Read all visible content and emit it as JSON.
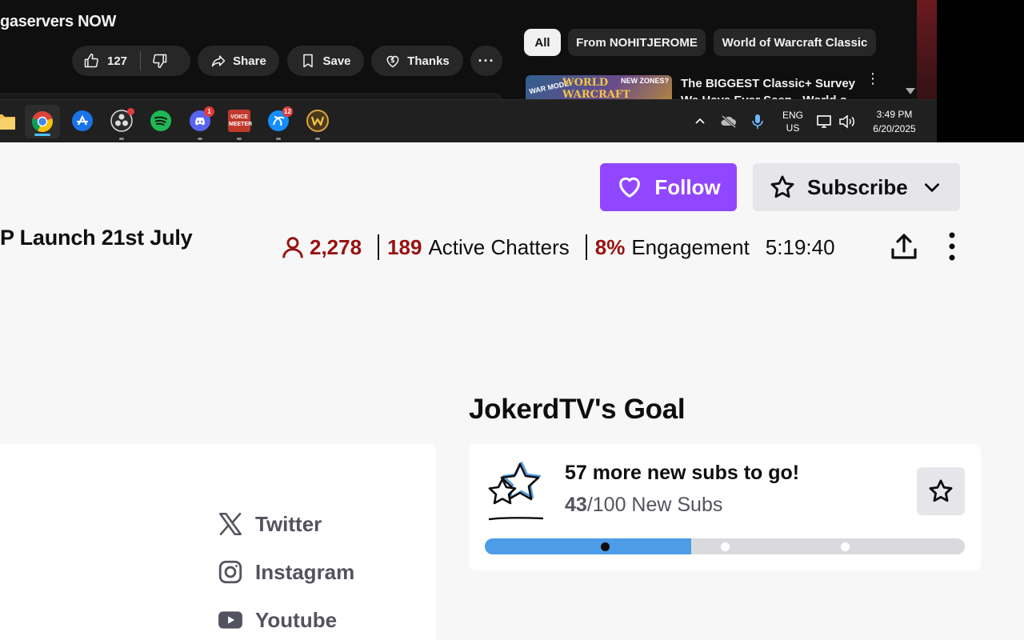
{
  "capture": {
    "video_title": "gaservers NOW",
    "actions": {
      "likes": "127",
      "share": "Share",
      "save": "Save",
      "thanks": "Thanks",
      "more": "···"
    },
    "chips": [
      "All",
      "From NOHITJEROME",
      "World of Warcraft Classic"
    ],
    "thumbnail": {
      "text_left": "WAR MODE!",
      "text_center": "WORLD WARCRAFT",
      "text_right": "NEW ZONES?"
    },
    "recommended_title": "The BIGGEST Classic+ Survey We Have Ever Seen - World o...",
    "taskbar": {
      "icons": [
        "folder-icon",
        "chrome-icon",
        "app-icon",
        "obs-icon",
        "spotify-icon",
        "discord-icon",
        "voicemeeter-icon",
        "battlenet-icon",
        "wow-icon"
      ],
      "badges": {
        "obs": "",
        "discord": "1",
        "battlenet": "12"
      },
      "voicemeeter_label": "VOICE MEETER",
      "lang_top": "ENG",
      "lang_bottom": "US",
      "time": "3:49 PM",
      "date": "6/20/2025"
    }
  },
  "header": {
    "follow_label": "Follow",
    "subscribe_label": "Subscribe"
  },
  "stream": {
    "title_fragment": "P Launch 21st July",
    "viewers": "2,278",
    "active_chatters_count": "189",
    "active_chatters_label": "Active Chatters",
    "engagement_value": "8%",
    "engagement_label": "Engagement",
    "uptime": "5:19:40"
  },
  "socials": [
    {
      "label": "Twitter"
    },
    {
      "label": "Instagram"
    },
    {
      "label": "Youtube"
    }
  ],
  "goal": {
    "heading": "JokerdTV's Goal",
    "headline": "57 more new subs to go!",
    "current": "43",
    "target_text": "/100 New Subs",
    "current_value": 43,
    "target_value": 100,
    "milestones": [
      25,
      50,
      75
    ]
  },
  "colors": {
    "twitch_purple": "#9147ff",
    "stat_red": "#971311",
    "progress_blue": "#4c9ce8"
  }
}
